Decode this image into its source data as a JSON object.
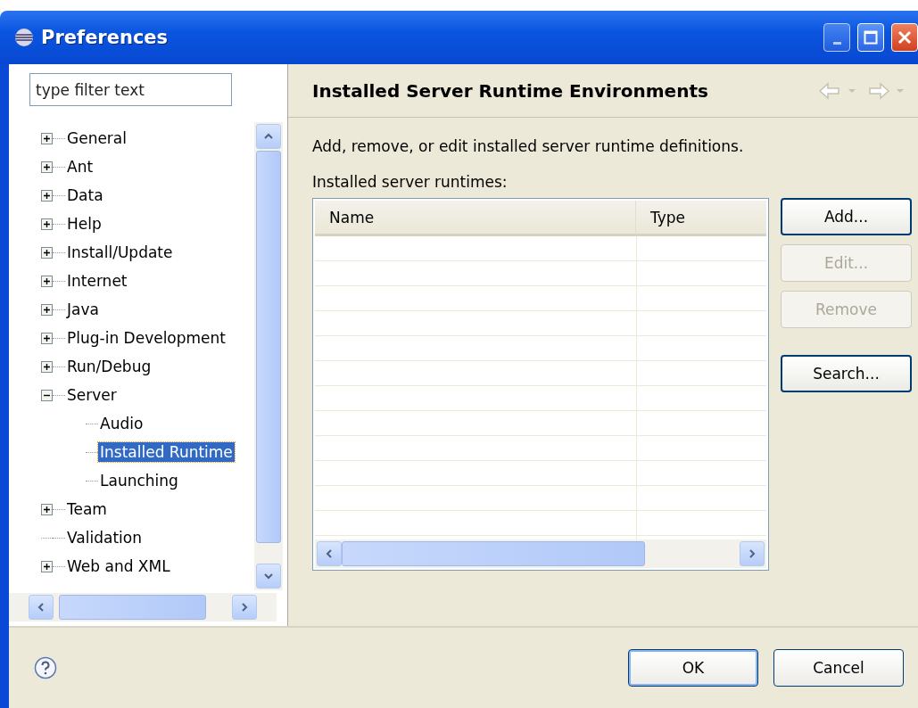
{
  "window": {
    "title": "Preferences"
  },
  "filter": {
    "placeholder": "type filter text"
  },
  "tree": [
    {
      "label": "General",
      "kind": "folder",
      "expanded": false,
      "selected": false
    },
    {
      "label": "Ant",
      "kind": "folder",
      "expanded": false,
      "selected": false
    },
    {
      "label": "Data",
      "kind": "folder",
      "expanded": false,
      "selected": false
    },
    {
      "label": "Help",
      "kind": "folder",
      "expanded": false,
      "selected": false
    },
    {
      "label": "Install/Update",
      "kind": "folder",
      "expanded": false,
      "selected": false
    },
    {
      "label": "Internet",
      "kind": "folder",
      "expanded": false,
      "selected": false
    },
    {
      "label": "Java",
      "kind": "folder",
      "expanded": false,
      "selected": false
    },
    {
      "label": "Plug-in Development",
      "kind": "folder",
      "expanded": false,
      "selected": false
    },
    {
      "label": "Run/Debug",
      "kind": "folder",
      "expanded": false,
      "selected": false
    },
    {
      "label": "Server",
      "kind": "folder",
      "expanded": true,
      "selected": false,
      "children": [
        {
          "label": "Audio",
          "kind": "leaf",
          "selected": false
        },
        {
          "label": "Installed Runtime",
          "kind": "leaf",
          "selected": true
        },
        {
          "label": "Launching",
          "kind": "leaf",
          "selected": false
        }
      ]
    },
    {
      "label": "Team",
      "kind": "folder",
      "expanded": false,
      "selected": false
    },
    {
      "label": "Validation",
      "kind": "leaf",
      "selected": false
    },
    {
      "label": "Web and XML",
      "kind": "folder",
      "expanded": false,
      "selected": false
    }
  ],
  "page": {
    "title": "Installed Server Runtime Environments",
    "description": "Add, remove, or edit installed server runtime definitions.",
    "list_label": "Installed server runtimes:",
    "table": {
      "columns": [
        "Name",
        "Type"
      ]
    },
    "button_groups": [
      [
        {
          "label": "Add...",
          "disabled": false
        },
        {
          "label": "Edit...",
          "disabled": true
        },
        {
          "label": "Remove",
          "disabled": true
        }
      ],
      [
        {
          "label": "Search...",
          "disabled": false
        }
      ]
    ]
  },
  "footer": {
    "buttons": [
      {
        "label": "OK",
        "default": true
      },
      {
        "label": "Cancel",
        "default": false
      }
    ]
  }
}
